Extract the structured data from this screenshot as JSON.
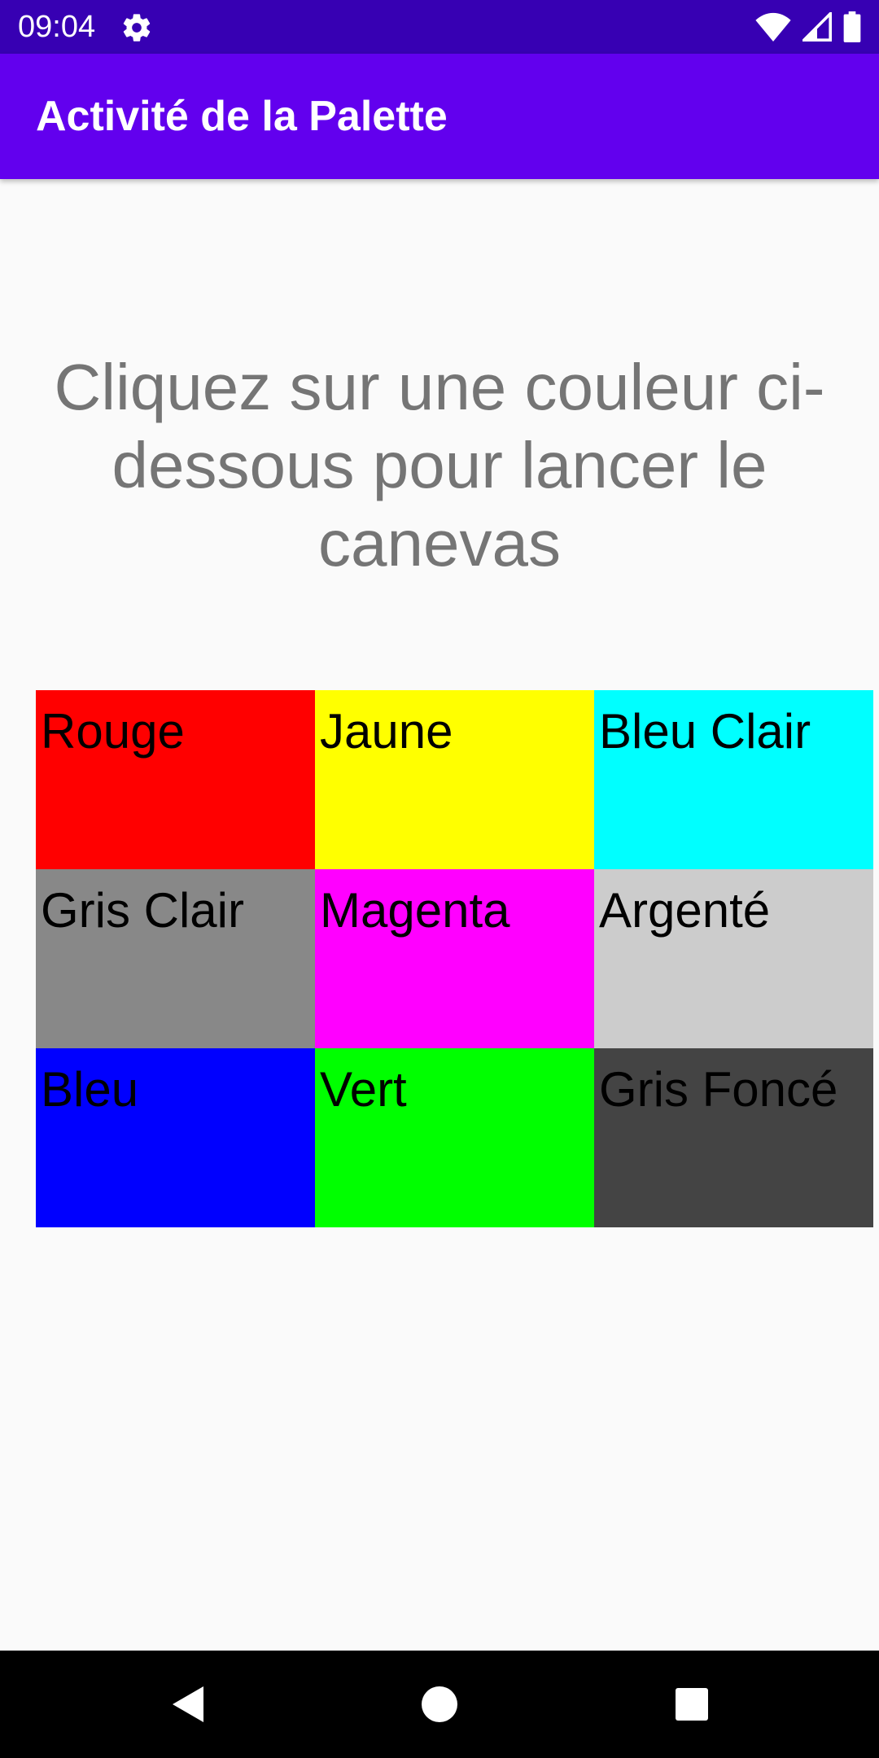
{
  "status_bar": {
    "time": "09:04",
    "settings_icon": "gear-icon",
    "wifi_icon": "wifi-icon",
    "signal_icon": "cell-signal-icon",
    "battery_icon": "battery-icon"
  },
  "app_bar": {
    "title": "Activité de la Palette",
    "background": "#6200EE"
  },
  "instructions": "Cliquez sur une couleur ci-dessous pour lancer le canevas",
  "palette": [
    {
      "label": "Rouge",
      "color": "#FF0000"
    },
    {
      "label": "Jaune",
      "color": "#FFFF00"
    },
    {
      "label": "Bleu Clair",
      "color": "#00FFFF"
    },
    {
      "label": "Gris Clair",
      "color": "#888888"
    },
    {
      "label": "Magenta",
      "color": "#FF00FF"
    },
    {
      "label": "Argenté",
      "color": "#CCCCCC"
    },
    {
      "label": "Bleu",
      "color": "#0000FF"
    },
    {
      "label": "Vert",
      "color": "#00FF00"
    },
    {
      "label": "Gris Foncé",
      "color": "#444444"
    }
  ],
  "nav_bar": {
    "back_icon": "back-triangle-icon",
    "home_icon": "home-circle-icon",
    "recents_icon": "recents-square-icon"
  }
}
